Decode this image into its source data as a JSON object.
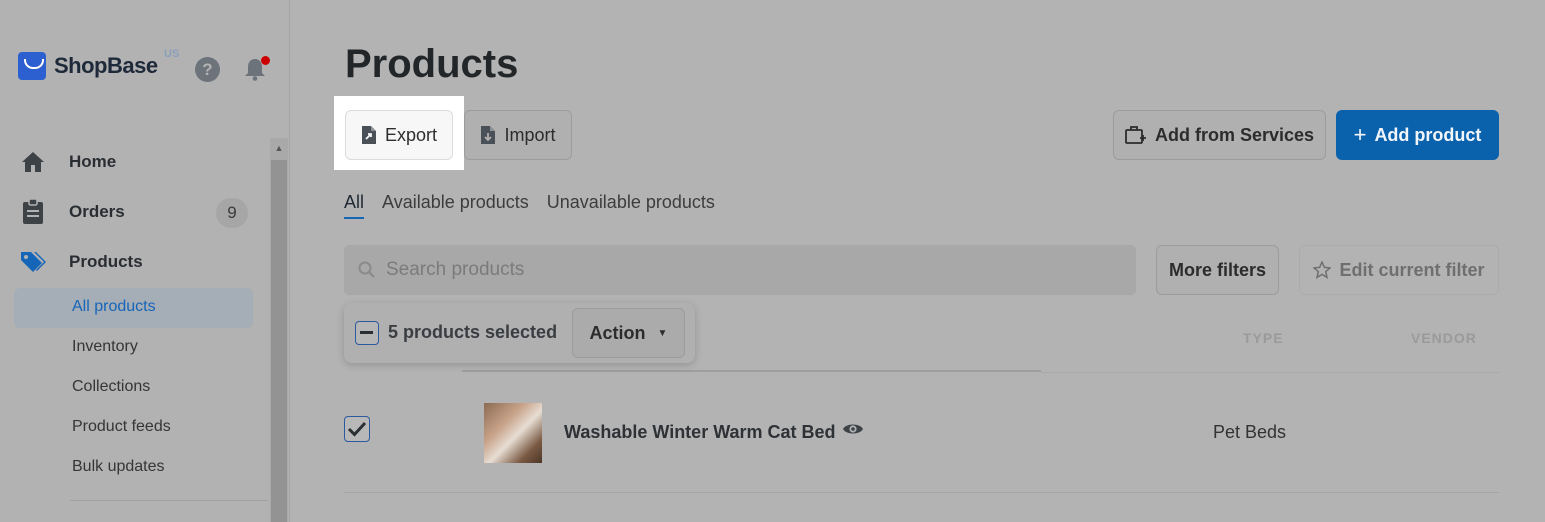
{
  "brand": {
    "name": "ShopBase",
    "region": "US"
  },
  "sidebar": {
    "items": [
      {
        "label": "Home",
        "icon": "home-icon"
      },
      {
        "label": "Orders",
        "icon": "clipboard-icon",
        "count": "9"
      },
      {
        "label": "Products",
        "icon": "tag-icon"
      }
    ],
    "sub_items": [
      {
        "label": "All products",
        "active": true
      },
      {
        "label": "Inventory"
      },
      {
        "label": "Collections"
      },
      {
        "label": "Product feeds"
      },
      {
        "label": "Bulk updates"
      }
    ]
  },
  "page": {
    "title": "Products",
    "export_label": "Export",
    "import_label": "Import",
    "services_label": "Add from Services",
    "add_label": "Add product",
    "add_plus": "+"
  },
  "tabs": [
    "All",
    "Available products",
    "Unavailable products"
  ],
  "search": {
    "placeholder": "Search products"
  },
  "filters": {
    "more": "More filters",
    "edit": "Edit current filter"
  },
  "bulk": {
    "selected_text": "5 products selected",
    "action_label": "Action"
  },
  "columns": {
    "type": "TYPE",
    "vendor": "VENDOR"
  },
  "products": [
    {
      "name": "Washable Winter Warm Cat Bed",
      "type": "Pet Beds",
      "checked": true
    }
  ],
  "colors": {
    "accent": "#0a62ad",
    "link": "#1565b8",
    "notification": "#cc0000"
  }
}
